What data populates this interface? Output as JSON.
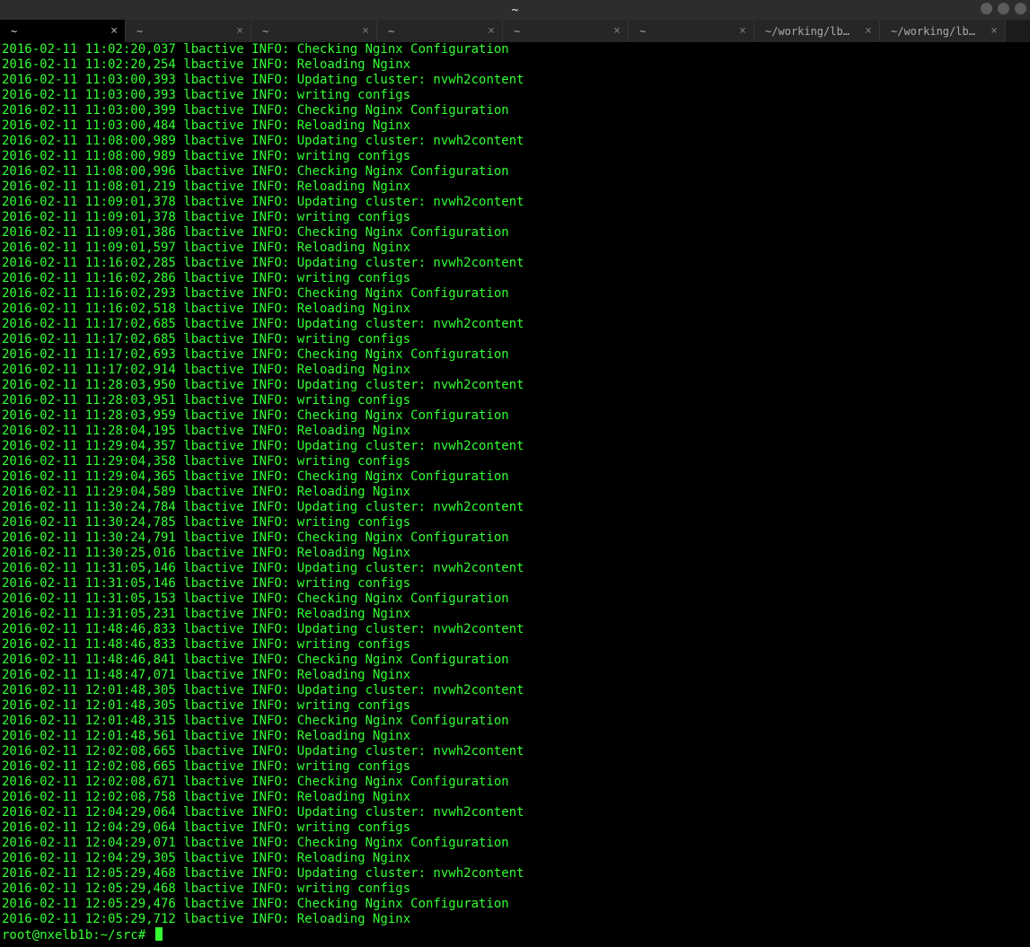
{
  "window": {
    "title": "~"
  },
  "tabs": [
    {
      "label": "~",
      "active": true
    },
    {
      "label": "~",
      "active": false
    },
    {
      "label": "~",
      "active": false
    },
    {
      "label": "~",
      "active": false
    },
    {
      "label": "~",
      "active": false
    },
    {
      "label": "~",
      "active": false
    },
    {
      "label": "~/working/lb…",
      "active": false
    },
    {
      "label": "~/working/lb…",
      "active": false
    }
  ],
  "log_lines": [
    "2016-02-11 11:02:20,037 lbactive INFO: Checking Nginx Configuration",
    "2016-02-11 11:02:20,254 lbactive INFO: Reloading Nginx",
    "2016-02-11 11:03:00,393 lbactive INFO: Updating cluster: nvwh2content",
    "2016-02-11 11:03:00,393 lbactive INFO: writing configs",
    "2016-02-11 11:03:00,399 lbactive INFO: Checking Nginx Configuration",
    "2016-02-11 11:03:00,484 lbactive INFO: Reloading Nginx",
    "2016-02-11 11:08:00,989 lbactive INFO: Updating cluster: nvwh2content",
    "2016-02-11 11:08:00,989 lbactive INFO: writing configs",
    "2016-02-11 11:08:00,996 lbactive INFO: Checking Nginx Configuration",
    "2016-02-11 11:08:01,219 lbactive INFO: Reloading Nginx",
    "2016-02-11 11:09:01,378 lbactive INFO: Updating cluster: nvwh2content",
    "2016-02-11 11:09:01,378 lbactive INFO: writing configs",
    "2016-02-11 11:09:01,386 lbactive INFO: Checking Nginx Configuration",
    "2016-02-11 11:09:01,597 lbactive INFO: Reloading Nginx",
    "2016-02-11 11:16:02,285 lbactive INFO: Updating cluster: nvwh2content",
    "2016-02-11 11:16:02,286 lbactive INFO: writing configs",
    "2016-02-11 11:16:02,293 lbactive INFO: Checking Nginx Configuration",
    "2016-02-11 11:16:02,518 lbactive INFO: Reloading Nginx",
    "2016-02-11 11:17:02,685 lbactive INFO: Updating cluster: nvwh2content",
    "2016-02-11 11:17:02,685 lbactive INFO: writing configs",
    "2016-02-11 11:17:02,693 lbactive INFO: Checking Nginx Configuration",
    "2016-02-11 11:17:02,914 lbactive INFO: Reloading Nginx",
    "2016-02-11 11:28:03,950 lbactive INFO: Updating cluster: nvwh2content",
    "2016-02-11 11:28:03,951 lbactive INFO: writing configs",
    "2016-02-11 11:28:03,959 lbactive INFO: Checking Nginx Configuration",
    "2016-02-11 11:28:04,195 lbactive INFO: Reloading Nginx",
    "2016-02-11 11:29:04,357 lbactive INFO: Updating cluster: nvwh2content",
    "2016-02-11 11:29:04,358 lbactive INFO: writing configs",
    "2016-02-11 11:29:04,365 lbactive INFO: Checking Nginx Configuration",
    "2016-02-11 11:29:04,589 lbactive INFO: Reloading Nginx",
    "2016-02-11 11:30:24,784 lbactive INFO: Updating cluster: nvwh2content",
    "2016-02-11 11:30:24,785 lbactive INFO: writing configs",
    "2016-02-11 11:30:24,791 lbactive INFO: Checking Nginx Configuration",
    "2016-02-11 11:30:25,016 lbactive INFO: Reloading Nginx",
    "2016-02-11 11:31:05,146 lbactive INFO: Updating cluster: nvwh2content",
    "2016-02-11 11:31:05,146 lbactive INFO: writing configs",
    "2016-02-11 11:31:05,153 lbactive INFO: Checking Nginx Configuration",
    "2016-02-11 11:31:05,231 lbactive INFO: Reloading Nginx",
    "2016-02-11 11:48:46,833 lbactive INFO: Updating cluster: nvwh2content",
    "2016-02-11 11:48:46,833 lbactive INFO: writing configs",
    "2016-02-11 11:48:46,841 lbactive INFO: Checking Nginx Configuration",
    "2016-02-11 11:48:47,071 lbactive INFO: Reloading Nginx",
    "2016-02-11 12:01:48,305 lbactive INFO: Updating cluster: nvwh2content",
    "2016-02-11 12:01:48,305 lbactive INFO: writing configs",
    "2016-02-11 12:01:48,315 lbactive INFO: Checking Nginx Configuration",
    "2016-02-11 12:01:48,561 lbactive INFO: Reloading Nginx",
    "2016-02-11 12:02:08,665 lbactive INFO: Updating cluster: nvwh2content",
    "2016-02-11 12:02:08,665 lbactive INFO: writing configs",
    "2016-02-11 12:02:08,671 lbactive INFO: Checking Nginx Configuration",
    "2016-02-11 12:02:08,758 lbactive INFO: Reloading Nginx",
    "2016-02-11 12:04:29,064 lbactive INFO: Updating cluster: nvwh2content",
    "2016-02-11 12:04:29,064 lbactive INFO: writing configs",
    "2016-02-11 12:04:29,071 lbactive INFO: Checking Nginx Configuration",
    "2016-02-11 12:04:29,305 lbactive INFO: Reloading Nginx",
    "2016-02-11 12:05:29,468 lbactive INFO: Updating cluster: nvwh2content",
    "2016-02-11 12:05:29,468 lbactive INFO: writing configs",
    "2016-02-11 12:05:29,476 lbactive INFO: Checking Nginx Configuration",
    "2016-02-11 12:05:29,712 lbactive INFO: Reloading Nginx"
  ],
  "prompt": {
    "user_host": "root@nxelb1b",
    "path": "~/src",
    "symbol": "#"
  }
}
